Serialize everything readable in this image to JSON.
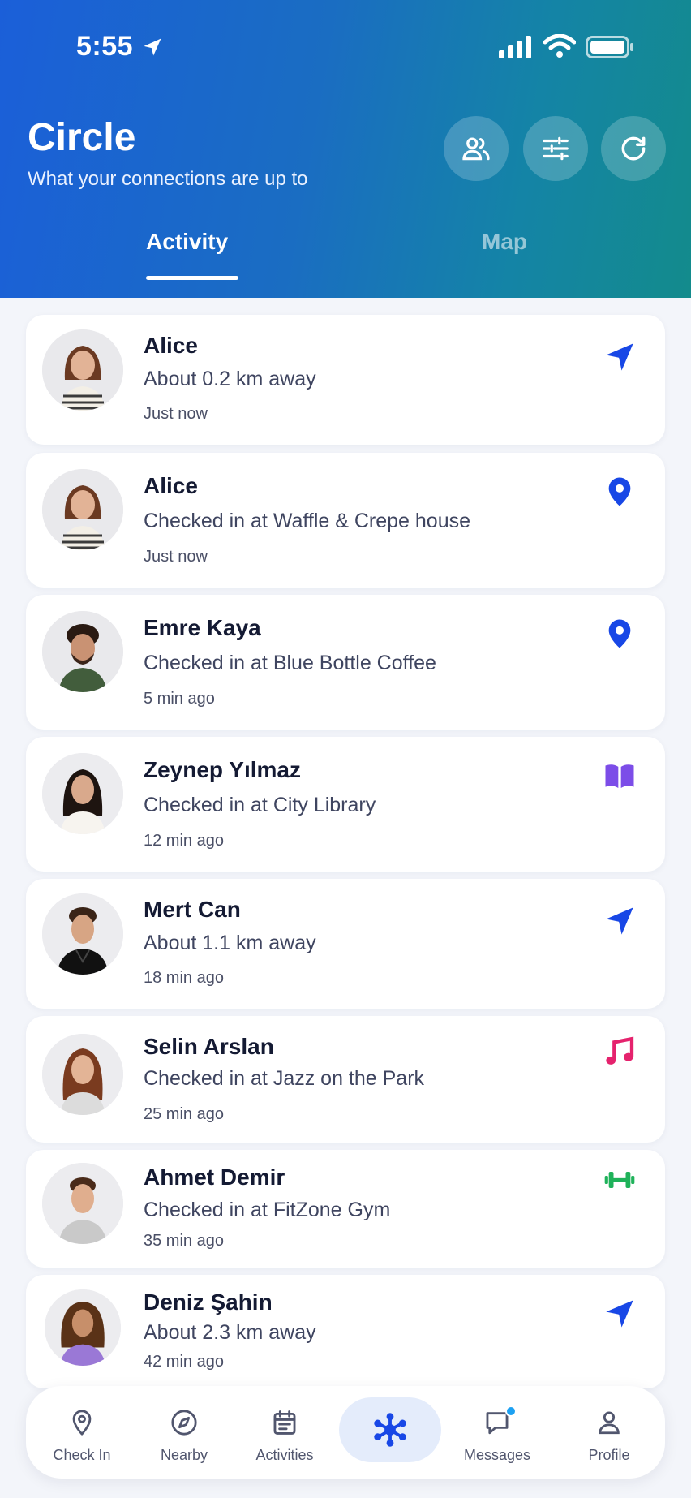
{
  "status_bar": {
    "time": "5:55"
  },
  "header": {
    "title": "Circle",
    "subtitle": "What your connections are up to",
    "buttons": [
      "people-icon",
      "sliders-icon",
      "refresh-icon"
    ],
    "tabs": [
      {
        "label": "Activity",
        "active": true
      },
      {
        "label": "Map",
        "active": false
      }
    ],
    "gradient": [
      "#1b5fd9",
      "#138b8c"
    ]
  },
  "feed": [
    {
      "name": "Alice",
      "text": "About 0.2 km away",
      "time": "Just now",
      "icon": "navigation-arrow-icon",
      "icon_color": "#1847e6"
    },
    {
      "name": "Alice",
      "text": "Checked in at Waffle & Crepe house",
      "time": "Just now",
      "icon": "map-pin-icon",
      "icon_color": "#1847e6"
    },
    {
      "name": "Emre Kaya",
      "text": "Checked in at Blue Bottle Coffee",
      "time": "5 min ago",
      "icon": "map-pin-icon",
      "icon_color": "#1847e6"
    },
    {
      "name": "Zeynep Yılmaz",
      "text": "Checked in at City Library",
      "time": "12 min ago",
      "icon": "book-icon",
      "icon_color": "#7c4de8"
    },
    {
      "name": "Mert Can",
      "text": "About 1.1 km away",
      "time": "18 min ago",
      "icon": "navigation-arrow-icon",
      "icon_color": "#1847e6"
    },
    {
      "name": "Selin Arslan",
      "text": "Checked in at Jazz on the Park",
      "time": "25 min ago",
      "icon": "music-note-icon",
      "icon_color": "#e5226d"
    },
    {
      "name": "Ahmet Demir",
      "text": "Checked in at FitZone Gym",
      "time": "35 min ago",
      "icon": "dumbbell-icon",
      "icon_color": "#1fb25a"
    },
    {
      "name": "Deniz Şahin",
      "text": "About 2.3 km away",
      "time": "42 min ago",
      "icon": "navigation-arrow-icon",
      "icon_color": "#1847e6"
    }
  ],
  "bottom_nav": [
    {
      "label": "Check In",
      "icon": "map-pin-icon"
    },
    {
      "label": "Nearby",
      "icon": "compass-icon"
    },
    {
      "label": "Activities",
      "icon": "calendar-icon"
    },
    {
      "label": "",
      "icon": "network-icon",
      "active": true
    },
    {
      "label": "Messages",
      "icon": "chat-icon",
      "badge": true
    },
    {
      "label": "Profile",
      "icon": "user-icon"
    }
  ],
  "accent_color": "#1847e6"
}
